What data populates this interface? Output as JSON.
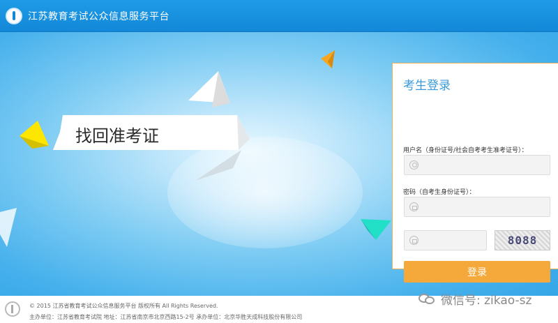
{
  "header": {
    "site_title": "江苏教育考试公众信息服务平台"
  },
  "banner": {
    "text": "找回准考证"
  },
  "login": {
    "title": "考生登录",
    "username_label": "用户名（身份证号/社会自考考生准考证号）：",
    "password_label": "密码（自考生身份证号）：",
    "captcha_text": "8088",
    "submit_label": "登录"
  },
  "footer": {
    "copyright": "© 2015 江苏省教育考试公众信息服务平台 版权所有 All Rights Reserved.",
    "organizer": "主办单位：江苏省教育考试院 地址：江苏省南京市北京西路15-2号 承办单位：北京华胜天成科技股份有限公司"
  },
  "watermark": {
    "text": "微信号: zikao-sz"
  },
  "colors": {
    "header_blue": "#1388d8",
    "title_blue": "#3a9ad9",
    "button_orange": "#f5a93a",
    "panel_border": "#f1b251"
  }
}
